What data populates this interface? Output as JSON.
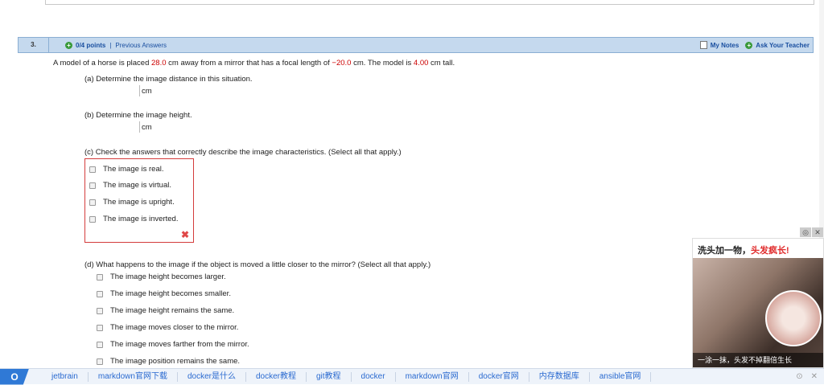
{
  "question": {
    "number": "3.",
    "plus_icon": "+",
    "points": "0/4 points",
    "separator": "|",
    "previous_answers": "Previous Answers",
    "my_notes": "My Notes",
    "ask_teacher": "Ask Your Teacher",
    "stem_parts": {
      "p1": "A model of a horse is placed ",
      "v1": "28.0",
      "p2": " cm away from a mirror that has a focal length of ",
      "v2": "−20.0",
      "p3": " cm.  The model is ",
      "v3": "4.00",
      "p4": " cm tall."
    },
    "part_a": {
      "label": "(a) Determine the image distance in this situation.",
      "unit": "cm",
      "value": ""
    },
    "part_b": {
      "label": "(b) Determine the image height.",
      "unit": "cm",
      "value": ""
    },
    "part_c": {
      "label": "(c) Check the answers that correctly describe the image characteristics. (Select all that apply.)",
      "options": [
        "The image is real.",
        "The image is virtual.",
        "The image is upright.",
        "The image is inverted."
      ],
      "result_icon": "✖"
    },
    "part_d": {
      "label": "(d) What happens to the image if the object is moved a little closer to the mirror? (Select all that apply.)",
      "options": [
        "The image height becomes larger.",
        "The image height becomes smaller.",
        "The image height remains the same.",
        "The image moves closer to the mirror.",
        "The image moves farther from the mirror.",
        "The image position remains the same."
      ]
    }
  },
  "ad": {
    "title_main": "洗头加一物，",
    "title_highlight": "头发疯长!",
    "caption": "一涂一抹，头发不掉翻倍生长",
    "controls": [
      "◎",
      "✕"
    ]
  },
  "bookmarks": {
    "search_icon": "O",
    "items": [
      "jetbrain",
      "markdown官网下载",
      "docker是什么",
      "docker教程",
      "git教程",
      "docker",
      "markdown官网",
      "docker官网",
      "内存数据库",
      "ansible官网"
    ],
    "right_icons": [
      "⊙",
      "✕"
    ]
  },
  "colors": {
    "accent": "#1a4fa0",
    "header_bg": "#c5d9ee",
    "error": "#d43c3c",
    "value_red": "#cc0000"
  }
}
